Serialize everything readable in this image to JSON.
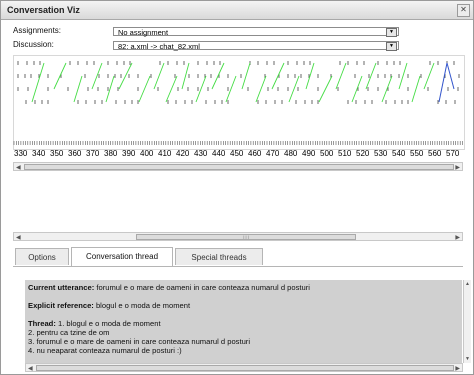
{
  "window": {
    "title": "Conversation Viz",
    "close_glyph": "✕"
  },
  "form": {
    "assignments_label": "Assignments:",
    "assignments_value": "No assignment",
    "discussion_label": "Discussion:",
    "discussion_value": "82: a.xml -> chat_82.xml"
  },
  "timeline": {
    "axis_ticks": [
      "330",
      "340",
      "350",
      "360",
      "370",
      "380",
      "390",
      "400",
      "410",
      "420",
      "430",
      "440",
      "450",
      "460",
      "470",
      "480",
      "490",
      "500",
      "510",
      "520",
      "530",
      "540",
      "550",
      "560",
      "570"
    ],
    "link_color": "#44dd44",
    "highlight_color": "#3355cc"
  },
  "tabs": [
    {
      "label": "Options",
      "active": false
    },
    {
      "label": "Conversation thread",
      "active": true
    },
    {
      "label": "Special threads",
      "active": false
    }
  ],
  "thread": {
    "current_label": "Current utterance:",
    "current_text": " forumul e o mare de oameni in care conteaza numarul d posturi",
    "explicit_label": "Explicit reference:",
    "explicit_text": " blogul e o moda de moment",
    "thread_label": "Thread:",
    "thread_text": " 1. blogul e o moda de moment",
    "items": [
      "2. pentru ca tzine de om",
      "3. forumul e o mare de oameni in care conteaza numarul d posturi",
      "4. nu neaparat conteaza numarul de posturi :)"
    ]
  },
  "icons": [
    "close-icon",
    "dropdown-arrow-icon",
    "scroll-left-icon",
    "scroll-right-icon",
    "scroll-up-icon",
    "scroll-down-icon",
    "grip-icon"
  ]
}
